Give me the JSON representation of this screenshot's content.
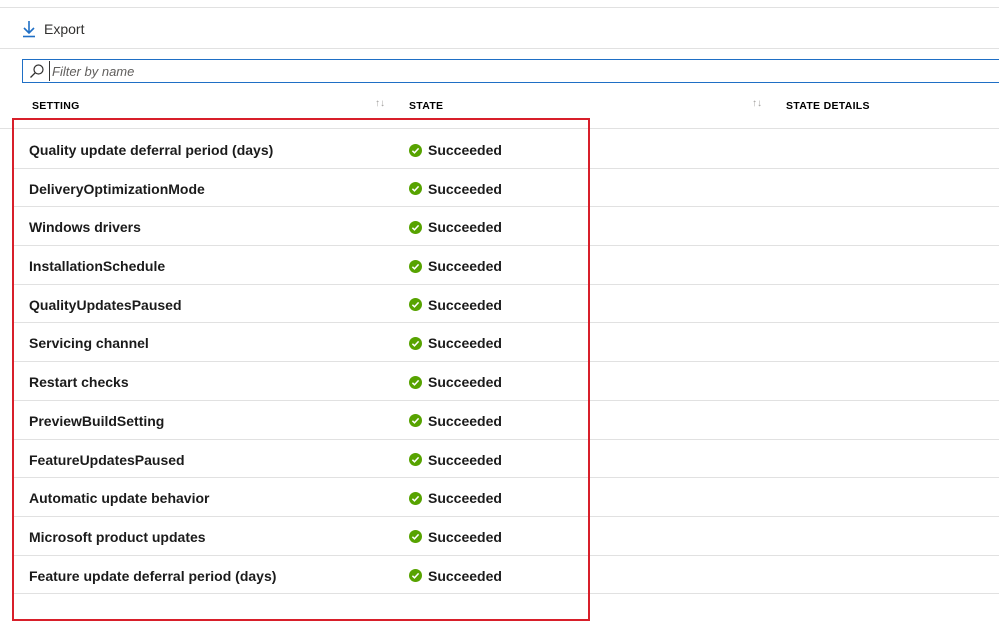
{
  "toolbar": {
    "export_label": "Export"
  },
  "filter": {
    "placeholder": "Filter by name",
    "value": ""
  },
  "columns": [
    {
      "label": "SETTING"
    },
    {
      "label": "STATE"
    },
    {
      "label": "STATE DETAILS"
    }
  ],
  "rows": [
    {
      "setting": "Quality update deferral period (days)",
      "state": "Succeeded"
    },
    {
      "setting": "DeliveryOptimizationMode",
      "state": "Succeeded"
    },
    {
      "setting": "Windows drivers",
      "state": "Succeeded"
    },
    {
      "setting": "InstallationSchedule",
      "state": "Succeeded"
    },
    {
      "setting": "QualityUpdatesPaused",
      "state": "Succeeded"
    },
    {
      "setting": "Servicing channel",
      "state": "Succeeded"
    },
    {
      "setting": "Restart checks",
      "state": "Succeeded"
    },
    {
      "setting": "PreviewBuildSetting",
      "state": "Succeeded"
    },
    {
      "setting": "FeatureUpdatesPaused",
      "state": "Succeeded"
    },
    {
      "setting": "Automatic update behavior",
      "state": "Succeeded"
    },
    {
      "setting": "Microsoft product updates",
      "state": "Succeeded"
    },
    {
      "setting": "Feature update deferral period (days)",
      "state": "Succeeded"
    }
  ],
  "colors": {
    "success": "#57a300",
    "highlight": "#d81f2a",
    "accent": "#1f6fc5"
  },
  "icons": {
    "export": "download-arrow-icon",
    "search": "search-icon",
    "sort": "sort-arrows-icon",
    "status": "check-circle-icon"
  }
}
